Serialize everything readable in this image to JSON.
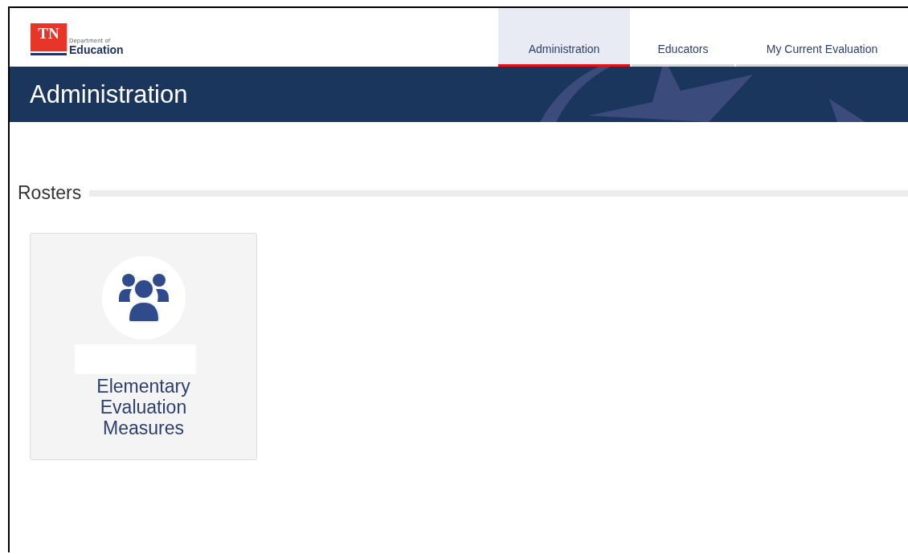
{
  "logo": {
    "mark": "TN",
    "line_1": "Department of",
    "line_2": "Education"
  },
  "tabs": [
    {
      "label": "Administration",
      "selected": true
    },
    {
      "label": "Educators",
      "selected": false
    },
    {
      "label": "My Current Evaluation",
      "selected": false
    }
  ],
  "banner": {
    "title": "Administration"
  },
  "section": {
    "title": "Rosters"
  },
  "cards": [
    {
      "title": "Elementary Evaluation Measures"
    }
  ]
}
